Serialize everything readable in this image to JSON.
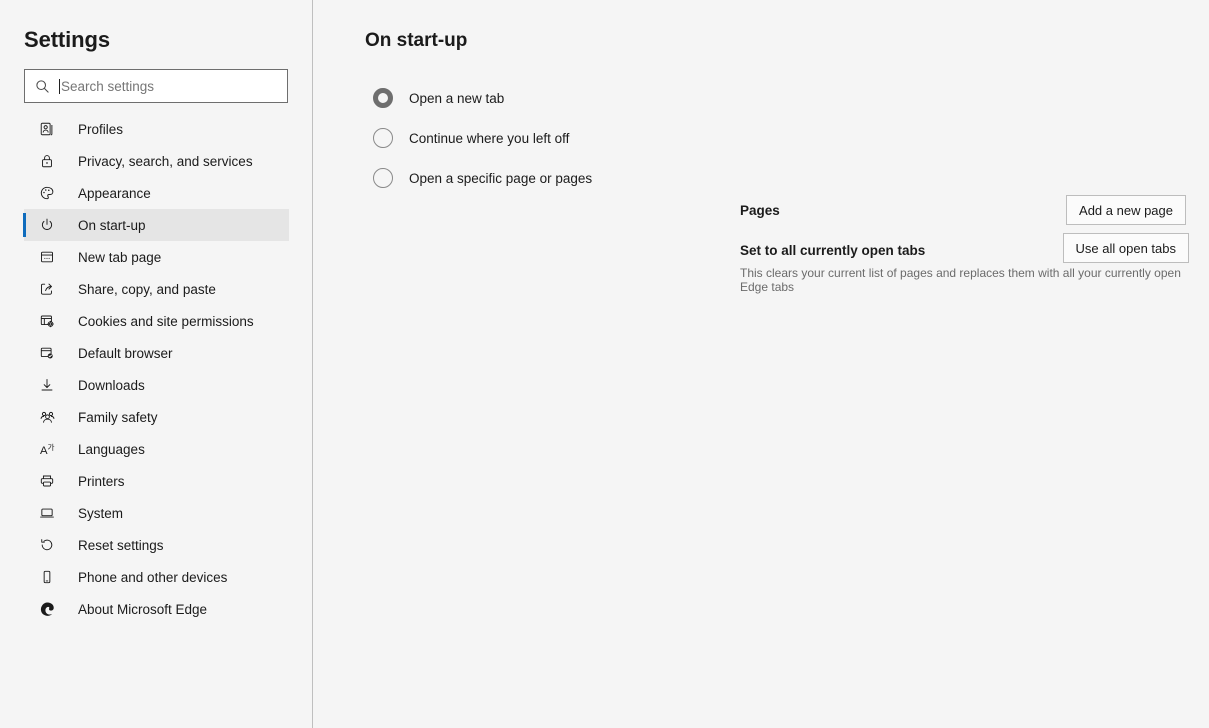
{
  "sidebar": {
    "title": "Settings",
    "search": {
      "placeholder": "Search settings",
      "value": "",
      "icon": "search-icon"
    },
    "items": [
      {
        "label": "Profiles",
        "icon": "profiles-icon",
        "selected": false
      },
      {
        "label": "Privacy, search, and services",
        "icon": "lock-icon",
        "selected": false
      },
      {
        "label": "Appearance",
        "icon": "palette-icon",
        "selected": false
      },
      {
        "label": "On start-up",
        "icon": "power-icon",
        "selected": true
      },
      {
        "label": "New tab page",
        "icon": "new-tab-page-icon",
        "selected": false
      },
      {
        "label": "Share, copy, and paste",
        "icon": "share-icon",
        "selected": false
      },
      {
        "label": "Cookies and site permissions",
        "icon": "cookies-icon",
        "selected": false
      },
      {
        "label": "Default browser",
        "icon": "default-browser-icon",
        "selected": false
      },
      {
        "label": "Downloads",
        "icon": "download-icon",
        "selected": false
      },
      {
        "label": "Family safety",
        "icon": "family-icon",
        "selected": false
      },
      {
        "label": "Languages",
        "icon": "languages-icon",
        "selected": false
      },
      {
        "label": "Printers",
        "icon": "printer-icon",
        "selected": false
      },
      {
        "label": "System",
        "icon": "system-icon",
        "selected": false
      },
      {
        "label": "Reset settings",
        "icon": "reset-icon",
        "selected": false
      },
      {
        "label": "Phone and other devices",
        "icon": "phone-icon",
        "selected": false
      },
      {
        "label": "About Microsoft Edge",
        "icon": "edge-logo-icon",
        "selected": false
      }
    ]
  },
  "main": {
    "title": "On start-up",
    "radio_options": [
      {
        "label": "Open a new tab",
        "checked": true
      },
      {
        "label": "Continue where you left off",
        "checked": false
      },
      {
        "label": "Open a specific page or pages",
        "checked": false
      }
    ],
    "pages_label": "Pages",
    "set_tabs_title": "Set to all currently open tabs",
    "set_tabs_description": "This clears your current list of pages and replaces them with all your currently open Edge tabs",
    "buttons": {
      "add_page": "Add a new page",
      "use_open_tabs": "Use all open tabs"
    }
  },
  "colors": {
    "accent": "#0f6cbd",
    "background": "#f5f5f5",
    "selected_row": "#e5e5e5",
    "text": "#1b1b1b",
    "muted_text": "#6b6b6b",
    "border": "#bfbfbf"
  }
}
